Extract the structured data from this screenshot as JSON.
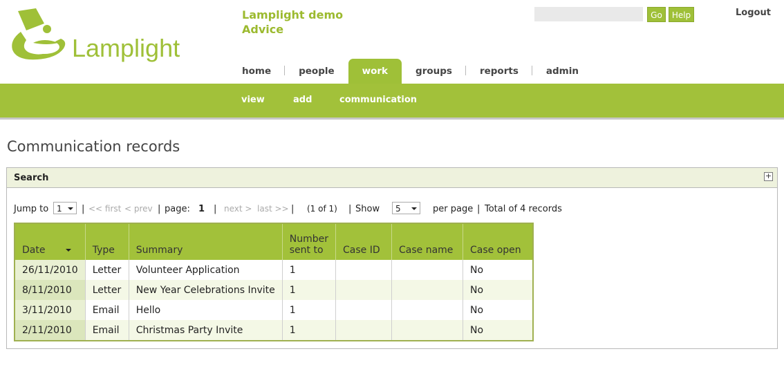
{
  "brand": {
    "name": "Lamplight",
    "accent": "#9fc038"
  },
  "header": {
    "org_line1": "Lamplight demo",
    "org_line2": "Advice",
    "search": {
      "value": "",
      "placeholder": ""
    },
    "go_label": "Go",
    "help_label": "Help",
    "logout_label": "Logout"
  },
  "nav": {
    "items": [
      {
        "label": "home"
      },
      {
        "label": "people"
      },
      {
        "label": "work",
        "active": true
      },
      {
        "label": "groups"
      },
      {
        "label": "reports"
      },
      {
        "label": "admin"
      }
    ]
  },
  "subnav": {
    "items": [
      {
        "label": "view"
      },
      {
        "label": "add"
      },
      {
        "label": "communication"
      }
    ]
  },
  "page": {
    "title": "Communication records"
  },
  "search_panel": {
    "title": "Search",
    "toggle_icon": "plus-icon"
  },
  "pager": {
    "jump_to_label": "Jump to",
    "jump_value": "1",
    "first_label": "<< first",
    "prev_label": "< prev",
    "page_label": "page:",
    "page_value": "1",
    "next_label": "next >",
    "last_label": "last >>",
    "page_of": "(1 of 1)",
    "show_label": "Show",
    "show_value": "5",
    "per_page_label": "per page",
    "total_label": "Total of 4 records"
  },
  "table": {
    "columns": [
      "Date",
      "Type",
      "Summary",
      "Number sent to",
      "Case ID",
      "Case name",
      "Case open"
    ],
    "column_lines": [
      [
        "Date"
      ],
      [
        "Type"
      ],
      [
        "Summary"
      ],
      [
        "Number",
        "sent to"
      ],
      [
        "Case ID"
      ],
      [
        "Case name"
      ],
      [
        "Case open"
      ]
    ],
    "rows": [
      [
        "26/11/2010",
        "Letter",
        "Volunteer Application",
        "1",
        "",
        "",
        "No"
      ],
      [
        "8/11/2010",
        "Letter",
        "New Year Celebrations Invite",
        "1",
        "",
        "",
        "No"
      ],
      [
        "3/11/2010",
        "Email",
        "Hello",
        "1",
        "",
        "",
        "No"
      ],
      [
        "2/11/2010",
        "Email",
        "Christmas Party Invite",
        "1",
        "",
        "",
        "No"
      ]
    ]
  }
}
